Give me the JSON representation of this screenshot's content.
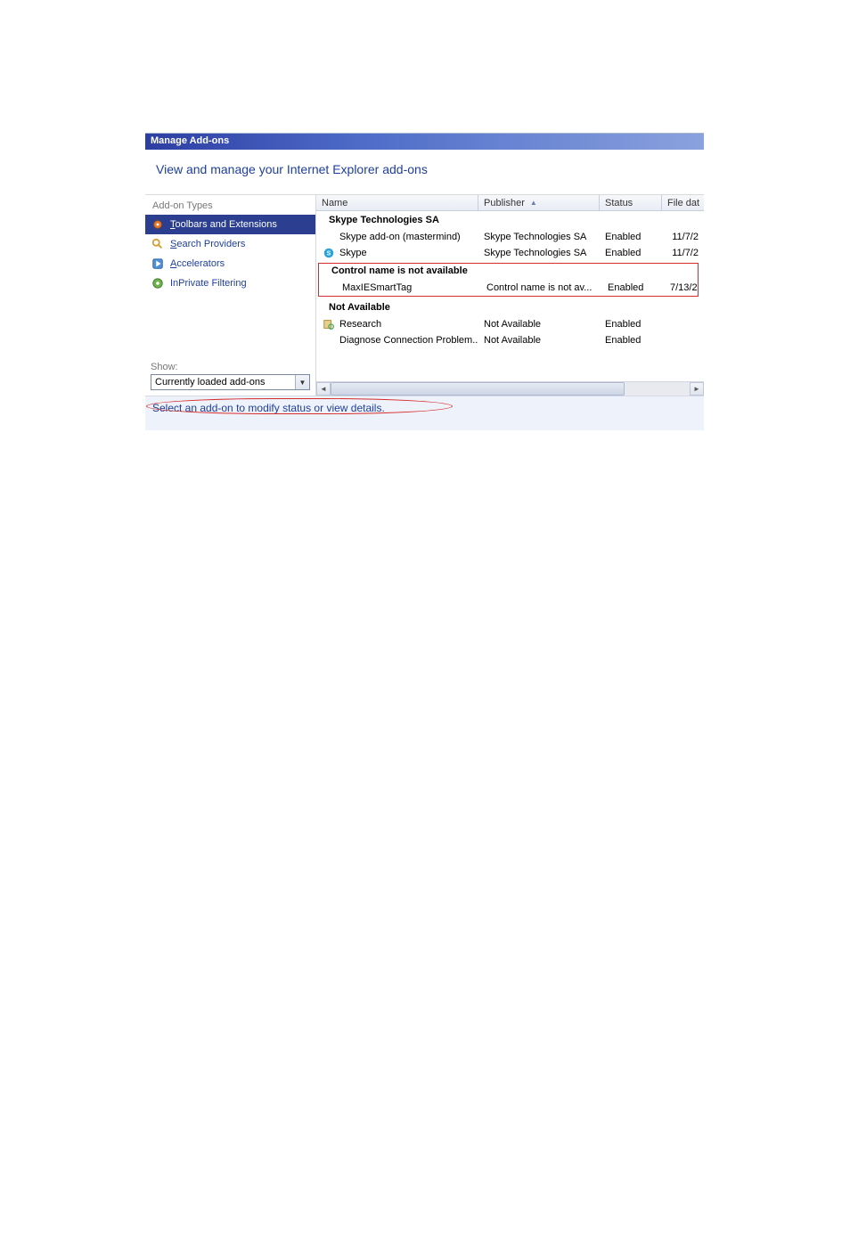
{
  "window": {
    "title": "Manage Add-ons",
    "heading": "View and manage your Internet Explorer add-ons"
  },
  "sidebar": {
    "header": "Add-on Types",
    "items": [
      {
        "label": "Toolbars and Extensions",
        "underline": "T",
        "selected": true,
        "icon": "gear"
      },
      {
        "label": "Search Providers",
        "underline": "S",
        "selected": false,
        "icon": "search"
      },
      {
        "label": "Accelerators",
        "underline": "A",
        "selected": false,
        "icon": "accel"
      },
      {
        "label": "InPrivate Filtering",
        "underline": "",
        "selected": false,
        "icon": "inprivate"
      }
    ],
    "show_label": "Show:",
    "show_value": "Currently loaded add-ons"
  },
  "columns": {
    "name": "Name",
    "publisher": "Publisher",
    "status": "Status",
    "file_date": "File dat"
  },
  "groups": [
    {
      "title": "Skype Technologies SA",
      "rows": [
        {
          "name": "Skype add-on (mastermind)",
          "publisher": "Skype Technologies SA",
          "status": "Enabled",
          "date": "11/7/2",
          "icon": ""
        },
        {
          "name": "Skype",
          "publisher": "Skype Technologies SA",
          "status": "Enabled",
          "date": "11/7/2",
          "icon": "skype"
        }
      ],
      "highlight": false
    },
    {
      "title": "Control name is not available",
      "rows": [
        {
          "name": "MaxIESmartTag",
          "publisher": "Control name is not av...",
          "status": "Enabled",
          "date": "7/13/2",
          "icon": ""
        }
      ],
      "highlight": true
    },
    {
      "title": "Not Available",
      "rows": [
        {
          "name": "Research",
          "publisher": "Not Available",
          "status": "Enabled",
          "date": "",
          "icon": "research"
        },
        {
          "name": "Diagnose Connection Problem...",
          "publisher": "Not Available",
          "status": "Enabled",
          "date": "",
          "icon": ""
        }
      ],
      "highlight": false
    }
  ],
  "detail_prompt": "Select an add-on to modify status or view details."
}
